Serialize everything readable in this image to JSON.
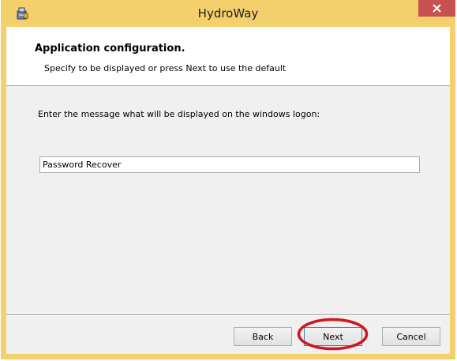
{
  "window": {
    "title": "HydroWay",
    "icon": "installer-icon",
    "close_icon": "close-icon"
  },
  "header": {
    "title": "Application configuration.",
    "subtitle": "Specify to be displayed or press Next to use the default"
  },
  "form": {
    "prompt": "Enter the message what will be displayed on the windows logon:",
    "message_value": "Password Recover"
  },
  "buttons": {
    "back": "Back",
    "next": "Next",
    "cancel": "Cancel"
  },
  "colors": {
    "titlebar": "#f4d06c",
    "close_button": "#c75050",
    "annotation": "#d0161f"
  }
}
